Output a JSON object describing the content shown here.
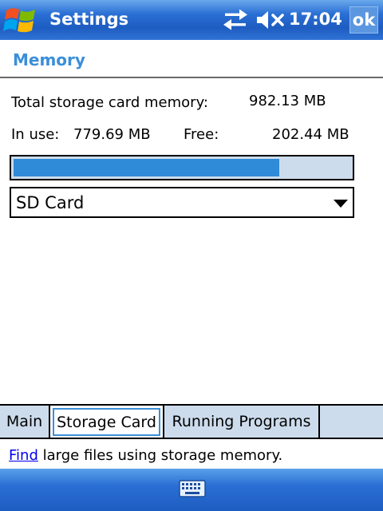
{
  "titlebar": {
    "title": "Settings",
    "clock": "17:04",
    "ok_label": "ok",
    "start_icon": "windows-flag-icon",
    "connectivity_icon": "connectivity-arrows-icon",
    "volume_icon": "volume-muted-icon"
  },
  "section": {
    "title": "Memory"
  },
  "memory": {
    "total_label": "Total storage card memory:",
    "total_value": "982.13 MB",
    "in_use_label": "In use:",
    "in_use_value": "779.69 MB",
    "free_label": "Free:",
    "free_value": "202.44 MB",
    "usage_fraction": 0.79
  },
  "storage_select": {
    "selected": "SD Card"
  },
  "tabs": [
    {
      "label": "Main",
      "selected": false
    },
    {
      "label": "Storage Card",
      "selected": true
    },
    {
      "label": "Running Programs",
      "selected": false
    }
  ],
  "footer": {
    "link_text": "Find",
    "text": " large files using storage memory."
  },
  "bottombar": {
    "keyboard_icon": "keyboard-icon"
  },
  "colors": {
    "accent": "#3b8fd9",
    "progress_fill": "#2f8ad8",
    "tab_background": "#cddcec",
    "titlebar": "#2a6fd4"
  }
}
